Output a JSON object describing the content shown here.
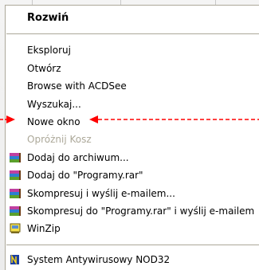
{
  "menu": {
    "header": "Rozwiń",
    "items": [
      "Eksploruj",
      "Otwórz",
      "Browse with ACDSee",
      "Wyszukaj...",
      "Nowe okno",
      "Opróżnij Kosz"
    ],
    "archive_items": [
      "Dodaj do archiwum...",
      "Dodaj do \"Programy.rar\"",
      "Skompresuj i wyślij e-mailem...",
      "Skompresuj do \"Programy.rar\" i wyślij e-mailem",
      "WinZip"
    ],
    "antivirus": "System Antywirusowy NOD32"
  },
  "colors": {
    "annotation_arrow": "#ff0000",
    "disabled_text": "#aca899",
    "separator": "#aca899"
  },
  "icons": {
    "rar": "winrar-books-icon",
    "winzip": "winzip-icon",
    "nod32": "nod32-icon"
  }
}
